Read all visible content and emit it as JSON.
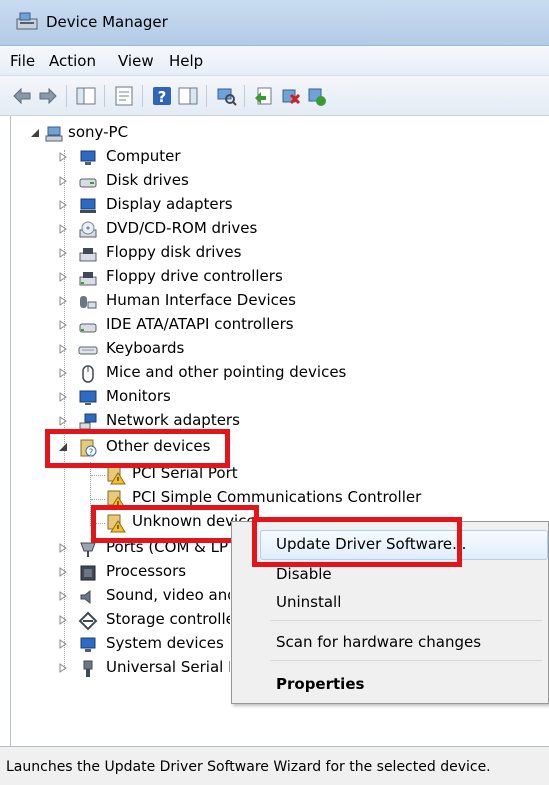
{
  "window": {
    "title": "Device Manager"
  },
  "menu": [
    "File",
    "Action",
    "View",
    "Help"
  ],
  "toolbar": {
    "icons": [
      "back-icon",
      "forward-icon",
      "show-hide-tree-icon",
      "properties-icon",
      "help-icon",
      "action-pane-icon",
      "scan-hardware-icon",
      "update-driver-icon",
      "uninstall-icon",
      "enable-icon"
    ]
  },
  "tree": {
    "root": "sony-PC",
    "categories": [
      "Computer",
      "Disk drives",
      "Display adapters",
      "DVD/CD-ROM drives",
      "Floppy disk drives",
      "Floppy drive controllers",
      "Human Interface Devices",
      "IDE ATA/ATAPI controllers",
      "Keyboards",
      "Mice and other pointing devices",
      "Monitors",
      "Network adapters",
      "Other devices"
    ],
    "other_devices_children": [
      "PCI Serial Port",
      "PCI Simple Communications Controller",
      "Unknown device"
    ],
    "after": [
      "Ports (COM & LPT)",
      "Processors",
      "Sound, video and game controllers",
      "Storage controllers",
      "System devices",
      "Universal Serial Bus controllers"
    ]
  },
  "context_menu": {
    "items": [
      "Update Driver Software...",
      "Disable",
      "Uninstall",
      "Scan for hardware changes",
      "Properties"
    ]
  },
  "status": "Launches the Update Driver Software Wizard for the selected device.",
  "colors": {
    "highlight_box": "#e5141b",
    "title_bar": "#c9dcf0"
  }
}
